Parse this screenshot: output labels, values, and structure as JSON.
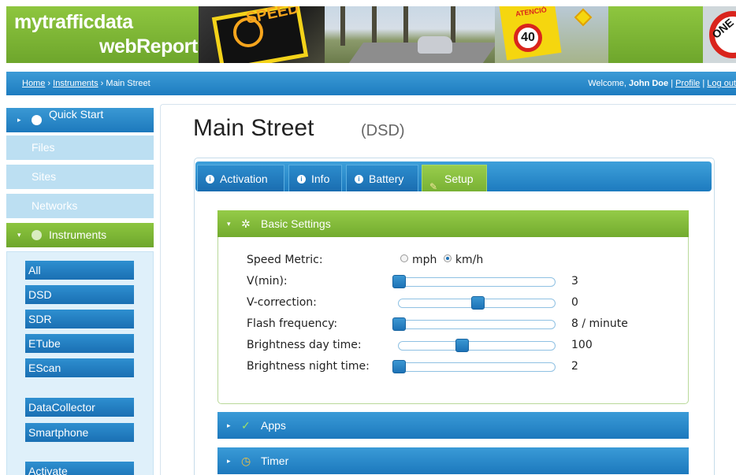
{
  "brand": {
    "line1": "mytrafficdata",
    "line2": "webReport"
  },
  "banner_photos": {
    "speed_sign_text": "SPEED",
    "atencio_text": "ATENCIÓ",
    "limit_value": "40",
    "right_sign_text": "ONE"
  },
  "breadcrumb": {
    "items": [
      "Home",
      "Instruments",
      "Main Street"
    ],
    "separator": "›"
  },
  "user": {
    "welcome": "Welcome,",
    "name": "John Doe",
    "profile": "Profile",
    "logout": "Log out",
    "divider": "|"
  },
  "sidebar": {
    "quick_start": "Quick Start",
    "files": "Files",
    "sites": "Sites",
    "networks": "Networks",
    "instruments": "Instruments",
    "instrument_items": [
      "All",
      "DSD",
      "SDR",
      "ETube",
      "EScan"
    ],
    "extra_items": [
      "DataCollector",
      "Smartphone"
    ],
    "activate": "Activate"
  },
  "page": {
    "title": "Main Street",
    "subtitle": "(DSD)"
  },
  "tabs": [
    {
      "label": "Activation",
      "active": false
    },
    {
      "label": "Info",
      "active": false
    },
    {
      "label": "Battery",
      "active": false
    },
    {
      "label": "Setup",
      "active": true
    }
  ],
  "sections": {
    "basic_settings": "Basic Settings",
    "apps": "Apps",
    "timer": "Timer"
  },
  "settings": {
    "speed_metric": {
      "label": "Speed Metric:",
      "options": [
        "mph",
        "km/h"
      ],
      "selected": "km/h"
    },
    "rows": [
      {
        "label": "V(min):",
        "value": "3",
        "level": 0.0
      },
      {
        "label": "V-correction:",
        "value": "0",
        "level": 0.5
      },
      {
        "label": "Flash frequency:",
        "value": "8 / minute",
        "level": 0.0
      },
      {
        "label": "Brightness day time:",
        "value": "100",
        "level": 0.4
      },
      {
        "label": "Brightness night time:",
        "value": "2",
        "level": 0.0
      }
    ]
  },
  "colors": {
    "green": "#7bb536",
    "blue": "#2a86c8",
    "faded_blue": "#bcdff2"
  },
  "icons": [
    "quick-start-icon",
    "gear-icon",
    "info-icon",
    "pencil-icon",
    "check-icon",
    "clock-icon",
    "caret-right-icon",
    "caret-down-icon"
  ]
}
